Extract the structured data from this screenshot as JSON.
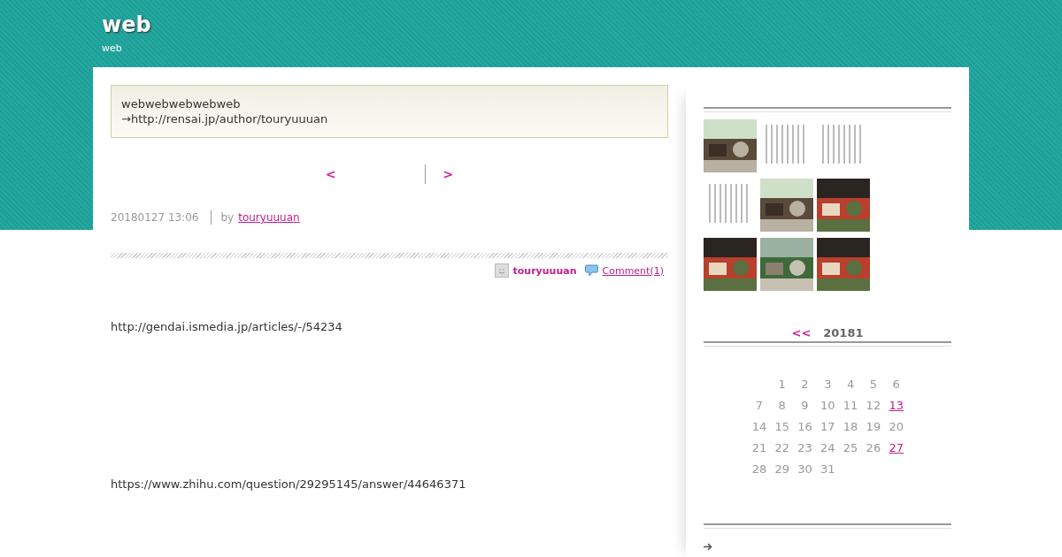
{
  "site": {
    "title": "web",
    "tagline": "web"
  },
  "notice": {
    "line_1": "webwebwebwebweb",
    "line_2": "→http://rensai.jp/author/touryuuuan"
  },
  "pager": {
    "prev": "<",
    "next": ">"
  },
  "post_meta": {
    "date": "20180127 13:06",
    "by": "by",
    "author": "touryuuuan"
  },
  "post_footer": {
    "author": "touryuuuan",
    "comments": "Comment(1)"
  },
  "body": [
    "http://gendai.ismedia.jp/articles/-/54234",
    "https://www.zhihu.com/question/29295145/answer/44646371"
  ],
  "thumbnails": [
    {
      "kind": "building"
    },
    {
      "kind": "document"
    },
    {
      "kind": "document"
    },
    {
      "kind": "document"
    },
    {
      "kind": "building"
    },
    {
      "kind": "food"
    },
    {
      "kind": "food"
    },
    {
      "kind": "garden"
    },
    {
      "kind": "food"
    }
  ],
  "calendar": {
    "prev": "<<",
    "title": "20181",
    "weeks": [
      [
        {
          "day": "1",
          "linked": false
        },
        {
          "day": "2",
          "linked": false
        },
        {
          "day": "3",
          "linked": false
        },
        {
          "day": "4",
          "linked": false
        },
        {
          "day": "5",
          "linked": false
        },
        {
          "day": "6",
          "linked": false
        }
      ],
      [
        {
          "day": "7",
          "linked": false
        },
        {
          "day": "8",
          "linked": false
        },
        {
          "day": "9",
          "linked": false
        },
        {
          "day": "10",
          "linked": false
        },
        {
          "day": "11",
          "linked": false
        },
        {
          "day": "12",
          "linked": false
        },
        {
          "day": "13",
          "linked": true
        }
      ],
      [
        {
          "day": "14",
          "linked": false
        },
        {
          "day": "15",
          "linked": false
        },
        {
          "day": "16",
          "linked": false
        },
        {
          "day": "17",
          "linked": false
        },
        {
          "day": "18",
          "linked": false
        },
        {
          "day": "19",
          "linked": false
        },
        {
          "day": "20",
          "linked": false
        }
      ],
      [
        {
          "day": "21",
          "linked": false
        },
        {
          "day": "22",
          "linked": false
        },
        {
          "day": "23",
          "linked": false
        },
        {
          "day": "24",
          "linked": false
        },
        {
          "day": "25",
          "linked": false
        },
        {
          "day": "26",
          "linked": false
        },
        {
          "day": "27",
          "linked": true
        }
      ],
      [
        {
          "day": "28",
          "linked": false
        },
        {
          "day": "29",
          "linked": false
        },
        {
          "day": "30",
          "linked": false
        },
        {
          "day": "31",
          "linked": false
        }
      ]
    ]
  }
}
